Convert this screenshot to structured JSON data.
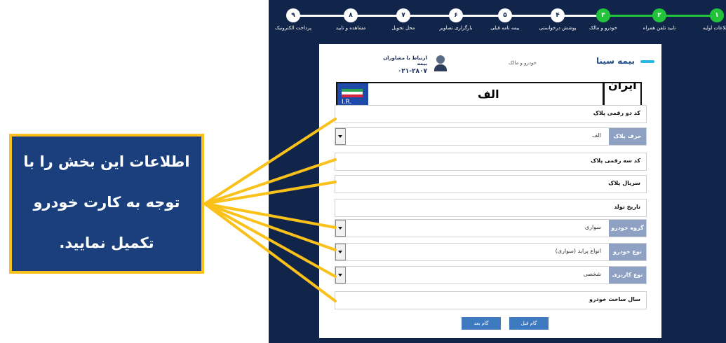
{
  "steps": [
    {
      "num": "۱",
      "label": "اطلاعات اولیه",
      "done": true
    },
    {
      "num": "۲",
      "label": "تایید تلفن همراه",
      "done": true
    },
    {
      "num": "۳",
      "label": "خودرو و مالک",
      "done": true
    },
    {
      "num": "۴",
      "label": "پوشش درخواستی",
      "done": false
    },
    {
      "num": "۵",
      "label": "بیمه نامه قبلی",
      "done": false
    },
    {
      "num": "۶",
      "label": "بارگزاری تصاویر",
      "done": false
    },
    {
      "num": "۷",
      "label": "محل تحویل",
      "done": false
    },
    {
      "num": "۸",
      "label": "مشاهده و تایید",
      "done": false
    },
    {
      "num": "۹",
      "label": "پرداخت الکترونیک",
      "done": false
    }
  ],
  "colors": {
    "done": "#22c23a",
    "pending": "#ffffff",
    "navy": "#11244a",
    "callout_border": "#f9c11a",
    "callout_bg": "#1b3f7c"
  },
  "header": {
    "brand": "بیمه سینا",
    "title": "خودرو و مالک",
    "contact_label": "ارتباط با مشاوران بیمه",
    "contact_phone": "۰۲۱-۲۸۰۷"
  },
  "plate": {
    "letter": "الف",
    "country": "ایران",
    "code": "I.R."
  },
  "form": {
    "two_digit": "کد دو رقمی پلاک",
    "plate_letter_tag": "حرف پلاک",
    "plate_letter_value": "الف",
    "three_digit": "کد سه رقمی پلاک",
    "serial": "سریال پلاک",
    "birth_date": "تاریخ تولد",
    "vehicle_group_tag": "گروه خودرو",
    "vehicle_group_value": "سواری",
    "vehicle_type_tag": "نوع خودرو",
    "vehicle_type_value": "انواع پراید (سواری)",
    "usage_tag": "نوع کاربری",
    "usage_value": "شخصی",
    "build_year": "سال ساخت خودرو"
  },
  "buttons": {
    "next": "گام بعد",
    "prev": "گام قبل"
  },
  "callout": {
    "line1": "اطلاعات این بخش را با",
    "line2": "توجه به کارت خودرو",
    "line3": "تکمیل نمایید."
  }
}
